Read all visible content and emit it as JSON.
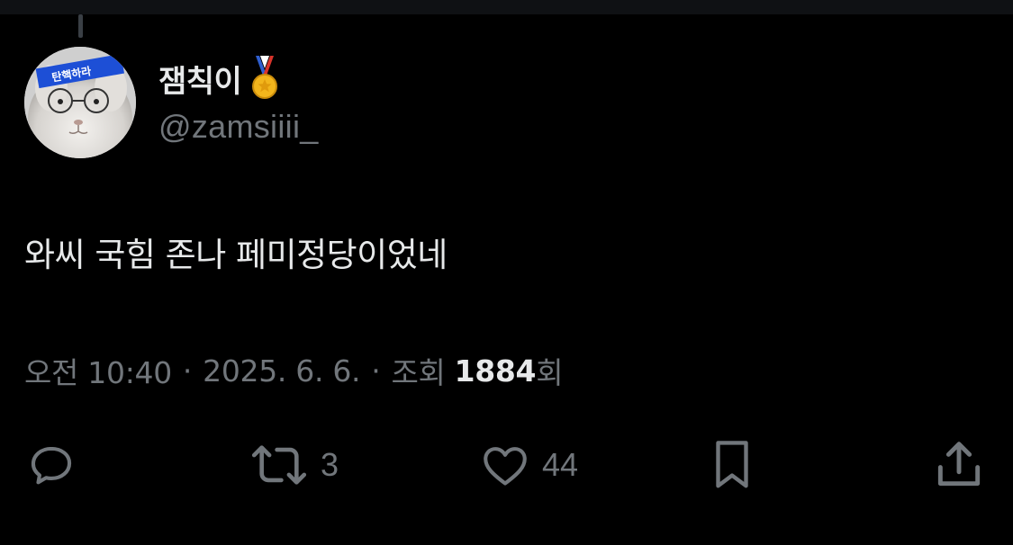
{
  "author": {
    "display_name": "잼칙이",
    "handle": "@zamsiiii_",
    "avatar_headband_text": "탄핵하라",
    "badge_icon": "medal-icon"
  },
  "tweet": {
    "text": "와씨 국힘 존나 페미정당이었네"
  },
  "meta": {
    "time": "오전 10:40",
    "separator": "·",
    "date": "2025. 6. 6.",
    "views_label_prefix": "조회",
    "views_count": "1884",
    "views_label_suffix": "회"
  },
  "actions": {
    "reply": {
      "icon": "reply-icon",
      "count": ""
    },
    "retweet": {
      "icon": "retweet-icon",
      "count": "3"
    },
    "like": {
      "icon": "heart-icon",
      "count": "44"
    },
    "bookmark": {
      "icon": "bookmark-icon",
      "count": ""
    },
    "share": {
      "icon": "share-icon",
      "count": ""
    }
  },
  "colors": {
    "background": "#000000",
    "primary_text": "#e7e9ea",
    "secondary_text": "#71767b",
    "headband": "#1d4fd6",
    "medal_gold": "#f2b51c",
    "ribbon_red": "#d9342b",
    "ribbon_blue": "#2f5fd0"
  }
}
